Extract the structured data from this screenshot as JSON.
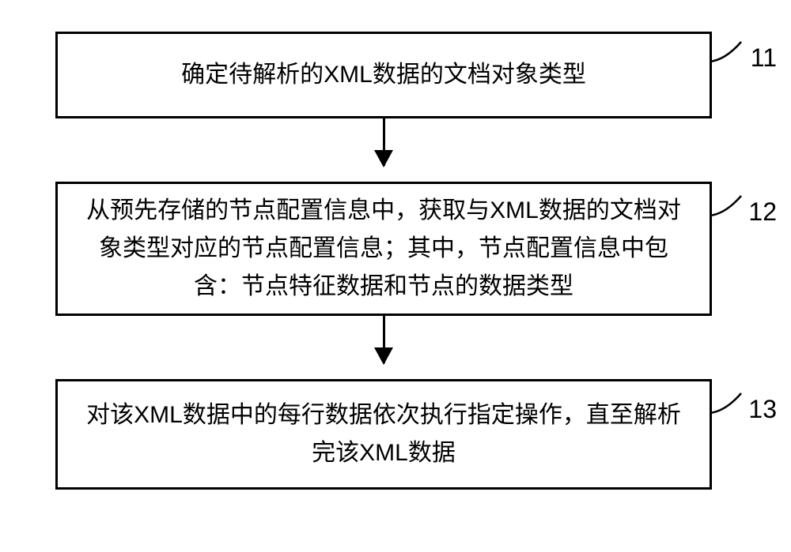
{
  "flowchart": {
    "steps": [
      {
        "id": "11",
        "text": "确定待解析的XML数据的文档对象类型"
      },
      {
        "id": "12",
        "text": "从预先存储的节点配置信息中，获取与XML数据的文档对象类型对应的节点配置信息；其中，节点配置信息中包含：节点特征数据和节点的数据类型"
      },
      {
        "id": "13",
        "text": "对该XML数据中的每行数据依次执行指定操作，直至解析完该XML数据"
      }
    ]
  }
}
